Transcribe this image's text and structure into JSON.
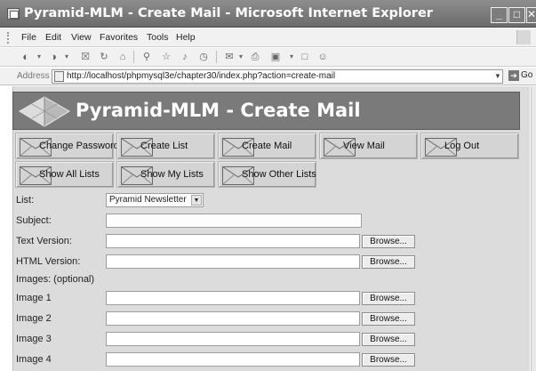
{
  "window": {
    "title": "Pyramid-MLM - Create Mail - Microsoft Internet Explorer",
    "buttons": [
      "_",
      "□",
      "✕"
    ]
  },
  "menu": [
    "File",
    "Edit",
    "View",
    "Favorites",
    "Tools",
    "Help"
  ],
  "address": {
    "label": "Address",
    "url": "http://localhost/phpmysql3e/chapter30/index.php?action=create-mail",
    "go_label": "Go"
  },
  "banner": {
    "title": "Pyramid-MLM - Create Mail"
  },
  "nav": {
    "row1": [
      "Change Password",
      "Create List",
      "Create Mail",
      "View Mail",
      "Log Out"
    ],
    "row2": [
      "Show All Lists",
      "Show My Lists",
      "Show Other Lists"
    ]
  },
  "form": {
    "list_label": "List:",
    "list_value": "Pyramid Newsletter",
    "subject_label": "Subject:",
    "text_version_label": "Text Version:",
    "html_version_label": "HTML Version:",
    "images_label": "Images: (optional)",
    "image_labels": [
      "Image 1",
      "Image 2",
      "Image 3",
      "Image 4"
    ],
    "browse_label": "Browse..."
  },
  "icons": {
    "logo": "pyramid-logo",
    "nav": "envelope-icon"
  },
  "colors": {
    "titlebar": "#7a7a7a",
    "banner": "#7a7a7a",
    "page_background": "#dcdcdc"
  }
}
